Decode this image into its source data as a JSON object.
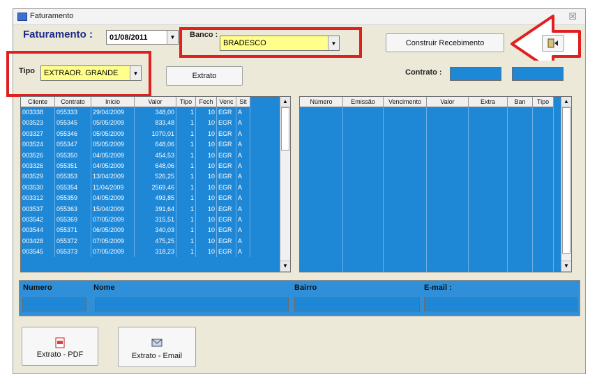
{
  "window": {
    "title": "Faturamento",
    "close_glyph": "☒"
  },
  "header": {
    "faturamento_label": "Faturamento :",
    "date_value": "01/08/2011",
    "banco_label": "Banco :",
    "banco_value": "BRADESCO",
    "construir_button": "Construir Recebimento",
    "tipo_label": "Tipo",
    "tipo_value": "EXTRAOR. GRANDE",
    "extrato_button": "Extrato",
    "contrato_label": "Contrato :",
    "exit_icon": "exit-door-icon"
  },
  "left_grid": {
    "columns": [
      "Cliente",
      "Contrato",
      "Inicio",
      "Valor",
      "Tipo",
      "Fech",
      "Venc",
      "Sit"
    ],
    "rows": [
      [
        "003338",
        "055333",
        "29/04/2009",
        "348,00",
        "1",
        "10",
        "EGR",
        "A"
      ],
      [
        "003523",
        "055345",
        "05/05/2009",
        "833,48",
        "1",
        "10",
        "EGR",
        "A"
      ],
      [
        "003327",
        "055346",
        "05/05/2009",
        "1070,01",
        "1",
        "10",
        "EGR",
        "A"
      ],
      [
        "003524",
        "055347",
        "05/05/2009",
        "648,06",
        "1",
        "10",
        "EGR",
        "A"
      ],
      [
        "003526",
        "055350",
        "04/05/2009",
        "454,53",
        "1",
        "10",
        "EGR",
        "A"
      ],
      [
        "003326",
        "055351",
        "04/05/2009",
        "648,06",
        "1",
        "10",
        "EGR",
        "A"
      ],
      [
        "003529",
        "055353",
        "13/04/2009",
        "526,25",
        "1",
        "10",
        "EGR",
        "A"
      ],
      [
        "003530",
        "055354",
        "11/04/2009",
        "2569,46",
        "1",
        "10",
        "EGR",
        "A"
      ],
      [
        "003312",
        "055359",
        "04/05/2009",
        "493,85",
        "1",
        "10",
        "EGR",
        "A"
      ],
      [
        "003537",
        "055363",
        "15/04/2009",
        "391,64",
        "1",
        "10",
        "EGR",
        "A"
      ],
      [
        "003542",
        "055369",
        "07/05/2009",
        "315,51",
        "1",
        "10",
        "EGR",
        "A"
      ],
      [
        "003544",
        "055371",
        "06/05/2009",
        "340,03",
        "1",
        "10",
        "EGR",
        "A"
      ],
      [
        "003428",
        "055372",
        "07/05/2009",
        "475,25",
        "1",
        "10",
        "EGR",
        "A"
      ],
      [
        "003545",
        "055373",
        "07/05/2009",
        "318,23",
        "1",
        "10",
        "EGR",
        "A"
      ]
    ]
  },
  "right_grid": {
    "columns": [
      "Número",
      "Emissão",
      "Vencimento",
      "Valor",
      "Extra",
      "Ban",
      "Tipo"
    ]
  },
  "footer": {
    "numero_label": "Numero",
    "nome_label": "Nome",
    "bairro_label": "Bairro",
    "email_label": "E-mail :",
    "extrato_pdf_button": "Extrato - PDF",
    "extrato_email_button": "Extrato - Email"
  },
  "colors": {
    "accent": "#e02020",
    "grid_blue": "#1e87d6",
    "highlight_yellow": "#ffff8a"
  }
}
